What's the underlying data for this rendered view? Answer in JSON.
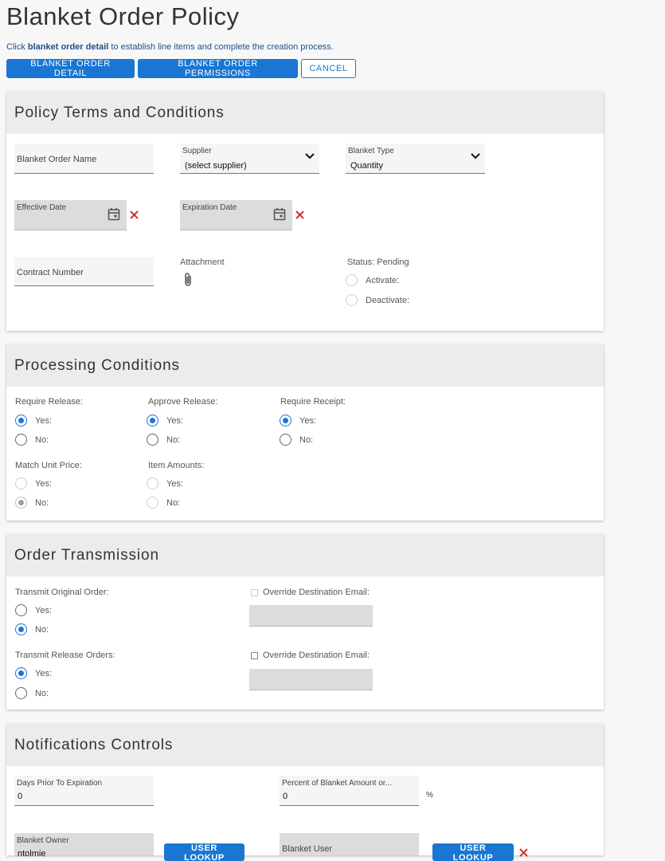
{
  "page": {
    "title": "Blanket Order Policy",
    "instruction_prefix": "Click ",
    "instruction_link": "blanket order detail",
    "instruction_suffix": " to establish line items and complete the creation process."
  },
  "toolbar": {
    "detail_label": "BLANKET ORDER DETAIL",
    "permissions_label": "BLANKET ORDER PERMISSIONS",
    "cancel_label": "CANCEL"
  },
  "policy_terms": {
    "title": "Policy Terms and Conditions",
    "blanket_order_name_label": "Blanket Order Name",
    "supplier_label": "Supplier",
    "supplier_value": "(select supplier)",
    "blanket_type_label": "Blanket Type",
    "blanket_type_value": "Quantity",
    "effective_date_label": "Effective Date",
    "expiration_date_label": "Expiration Date",
    "contract_number_label": "Contract Number",
    "attachment_label": "Attachment",
    "status_label": "Status: Pending",
    "activate_label": "Activate:",
    "deactivate_label": "Deactivate:"
  },
  "processing": {
    "title": "Processing Conditions",
    "require_release_label": "Require Release:",
    "approve_release_label": "Approve Release:",
    "require_receipt_label": "Require Receipt:",
    "match_unit_price_label": "Match Unit Price:",
    "item_amounts_label": "Item Amounts:",
    "yes": "Yes:",
    "no": "No:"
  },
  "transmission": {
    "title": "Order Transmission",
    "transmit_original_label": "Transmit Original Order:",
    "transmit_release_label": "Transmit Release Orders:",
    "override_email_label": "Override Destination Email:",
    "yes": "Yes:",
    "no": "No:"
  },
  "notifications": {
    "title": "Notifications Controls",
    "days_prior_label": "Days Prior To Expiration",
    "days_prior_value": "0",
    "percent_label": "Percent of Blanket Amount or...",
    "percent_value": "0",
    "percent_sign": "%",
    "blanket_owner_label": "Blanket Owner",
    "blanket_owner_value": "ntolmie",
    "blanket_user_label": "Blanket User",
    "user_lookup_label": "USER LOOKUP"
  },
  "colors": {
    "accent": "#1976d2",
    "danger": "#d32f2f",
    "header_bg": "#ececec"
  },
  "icons": {
    "select": "chevron-down-icon",
    "date": "calendar-icon",
    "clear": "close-icon",
    "attach": "paperclip-icon"
  }
}
